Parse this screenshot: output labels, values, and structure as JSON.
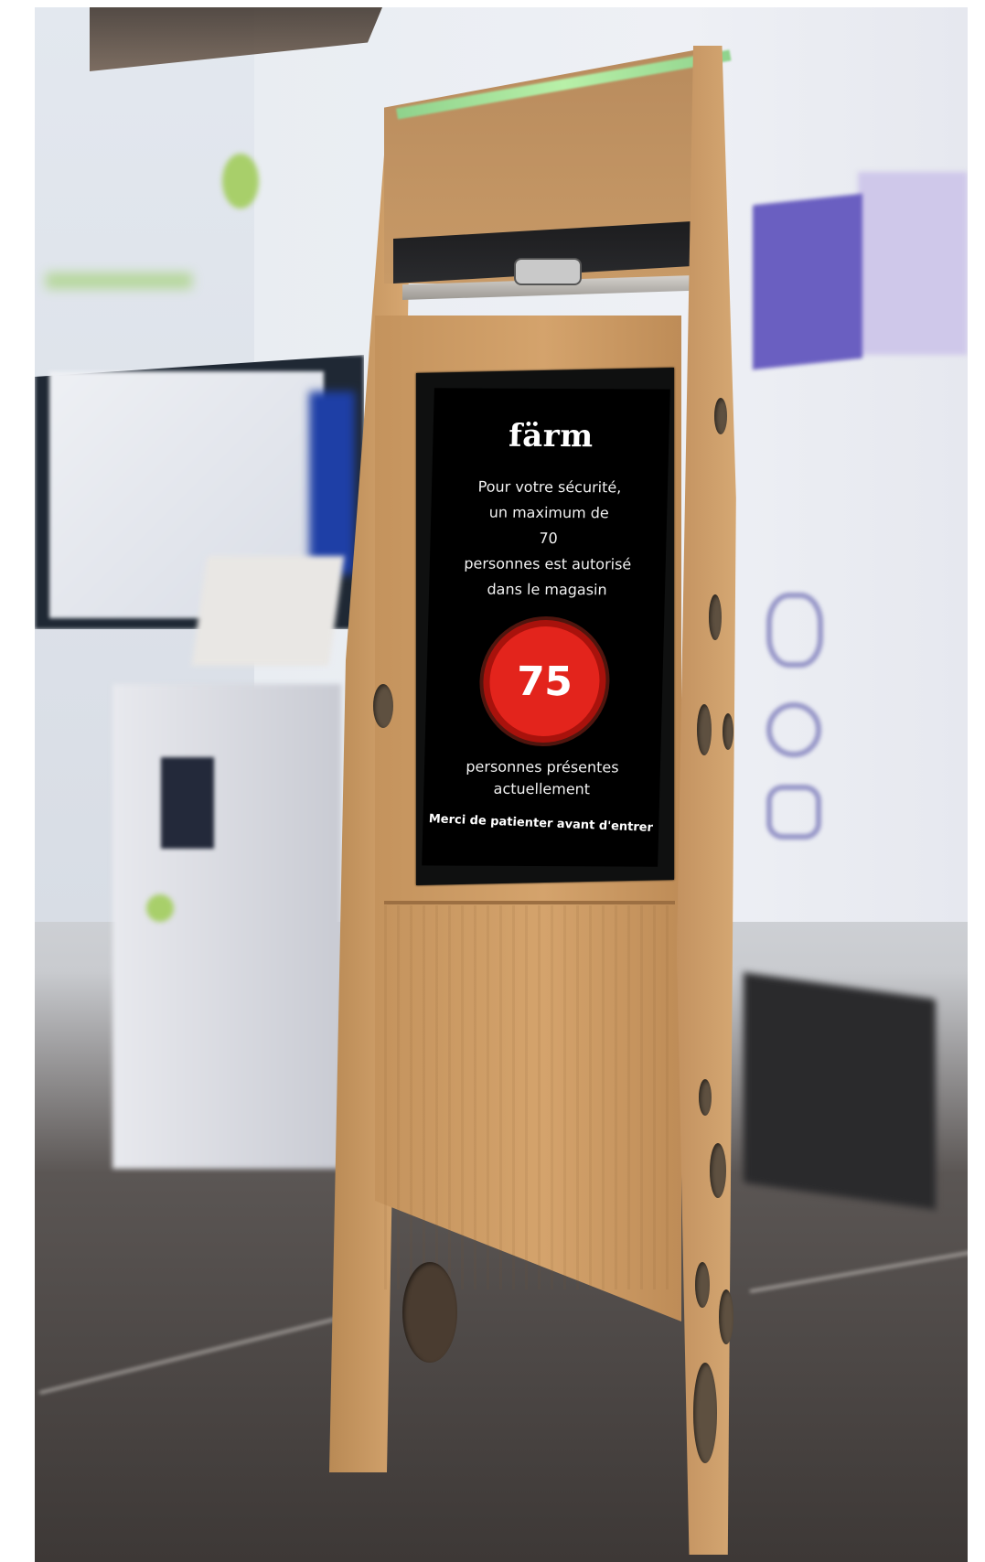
{
  "kiosk_screen": {
    "brand": "färm",
    "message_line1": "Pour votre sécurité,",
    "message_line2": "un maximum de",
    "max_capacity": "70",
    "message_line4": "personnes est autorisé",
    "message_line5": "dans le magasin",
    "current_count": "75",
    "present_line1": "personnes présentes",
    "present_line2": "actuellement",
    "wait_notice": "Merci de patienter avant d'entrer"
  },
  "colors": {
    "counter_red": "#e3241c",
    "screen_black": "#000000",
    "wood": "#d4a36c",
    "led_green": "#b8f0a8"
  }
}
